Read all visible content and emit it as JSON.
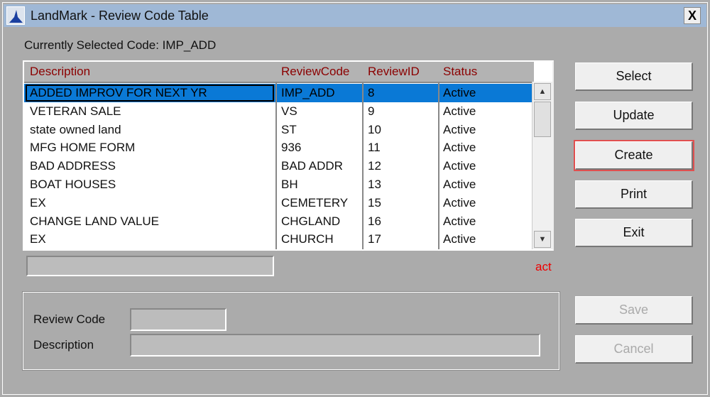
{
  "window": {
    "title": "LandMark - Review Code Table",
    "close": "X"
  },
  "selected_label": "Currently Selected Code: IMP_ADD",
  "table": {
    "headers": [
      "Description",
      "ReviewCode",
      "ReviewID",
      "Status"
    ],
    "rows": [
      [
        "ADDED IMPROV FOR NEXT YR",
        "IMP_ADD",
        "8",
        "Active"
      ],
      [
        "VETERAN SALE",
        "VS",
        "9",
        "Active"
      ],
      [
        "state owned land",
        "ST",
        "10",
        "Active"
      ],
      [
        "MFG HOME FORM",
        "936",
        "11",
        "Active"
      ],
      [
        "BAD ADDRESS",
        "BAD ADDR",
        "12",
        "Active"
      ],
      [
        "BOAT HOUSES",
        "BH",
        "13",
        "Active"
      ],
      [
        "EX",
        "CEMETERY",
        "15",
        "Active"
      ],
      [
        "CHANGE LAND VALUE",
        "CHGLAND",
        "16",
        "Active"
      ],
      [
        "EX",
        "CHURCH",
        "17",
        "Active"
      ]
    ]
  },
  "filter_status": "act",
  "form": {
    "review_code_label": "Review Code",
    "description_label": "Description",
    "review_code_value": "",
    "description_value": ""
  },
  "buttons": {
    "select": "Select",
    "update": "Update",
    "create": "Create",
    "print": "Print",
    "exit": "Exit",
    "save": "Save",
    "cancel": "Cancel"
  }
}
